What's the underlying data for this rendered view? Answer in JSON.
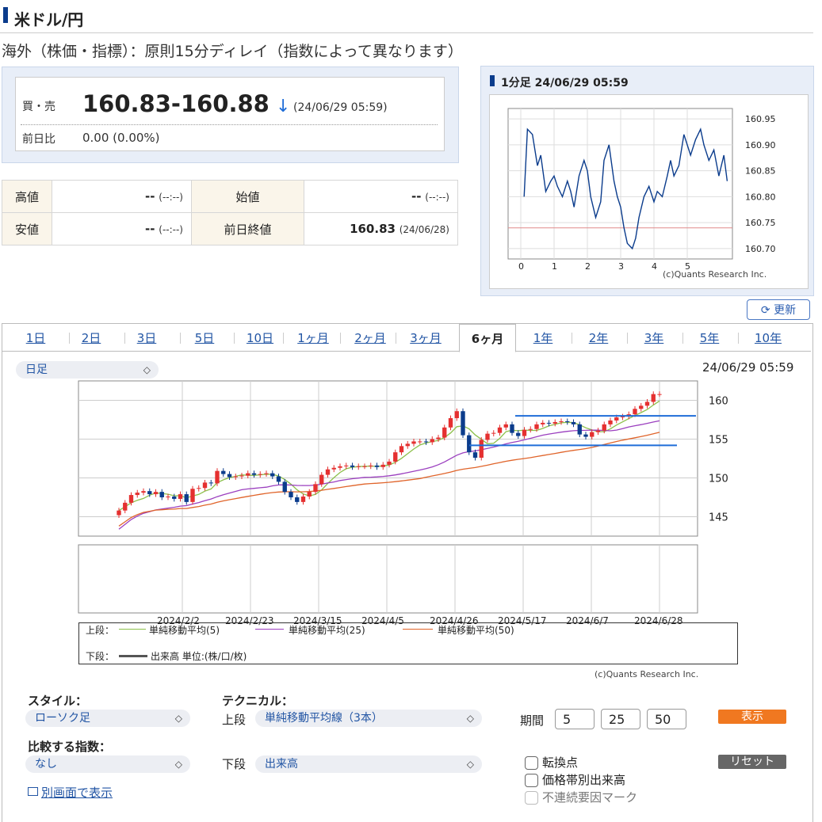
{
  "header": {
    "title": "米ドル/円",
    "subtitle": "海外（株価・指標）：原則15分ディレイ（指数によって異なります）"
  },
  "quote": {
    "bidask_label": "買・売",
    "price": "160.83-160.88",
    "arrow": "↓",
    "time": "(24/06/29 05:59)",
    "change_label": "前日比",
    "change": "0.00 (0.00%)"
  },
  "hl_table": {
    "high_label": "高値",
    "high_value": "--",
    "high_time": "(--:--)",
    "open_label": "始値",
    "open_value": "--",
    "open_time": "(--:--)",
    "low_label": "安値",
    "low_value": "--",
    "low_time": "(--:--)",
    "prev_close_label": "前日終値",
    "prev_close_value": "160.83",
    "prev_close_date": "(24/06/28)"
  },
  "mini_chart": {
    "title": "1分足 24/06/29 05:59",
    "credit": "(c)Quants Research Inc.",
    "y_ticks": [
      "160.95",
      "160.90",
      "160.85",
      "160.80",
      "160.75",
      "160.70"
    ],
    "x_ticks": [
      "0",
      "1",
      "2",
      "3",
      "4",
      "5"
    ]
  },
  "refresh_label": "更新",
  "tabs": [
    "1日",
    "2日",
    "3日",
    "5日",
    "10日",
    "1ヶ月",
    "2ヶ月",
    "3ヶ月",
    "6ヶ月",
    "1年",
    "2年",
    "3年",
    "5年",
    "10年"
  ],
  "active_tab": "6ヶ月",
  "chart_controls": {
    "period_select": "日足",
    "timestamp": "24/06/29 05:59"
  },
  "legend": {
    "upper_label": "上段：",
    "ma5": "単純移動平均(5)",
    "ma25": "単純移動平均(25)",
    "ma50": "単純移動平均(50)",
    "lower_label": "下段：",
    "volume": "出来高 単位:(株/口/枚)"
  },
  "chart_credit": "(c)Quants Research Inc.",
  "controls": {
    "style_label": "スタイル：",
    "style_value": "ローソク足",
    "compare_label": "比較する指数：",
    "compare_value": "なし",
    "technical_label": "テクニカル：",
    "upper_row_label": "上段",
    "upper_value": "単純移動平均線（3本）",
    "lower_row_label": "下段",
    "lower_value": "出来高",
    "period_label": "期間",
    "period1": "5",
    "period2": "25",
    "period3": "50",
    "show_button": "表示",
    "reset_button": "リセット",
    "cb_turning": "転換点",
    "cb_volume_by_price": "価格帯別出来高",
    "cb_discontinuity": "不連続要因マーク",
    "open_new_window": "別画面で表示"
  },
  "colors": {
    "candle_up": "#e53030",
    "candle_down": "#0b3c8c",
    "ma5": "#8cc04a",
    "ma25": "#9b3fbf",
    "ma50": "#e0642a",
    "line_blue": "#1f6dd8",
    "accent_orange": "#f07820"
  },
  "chart_data": [
    {
      "type": "line",
      "title": "1分足 24/06/29 05:59",
      "x_ticks": [
        "0",
        "1",
        "2",
        "3",
        "4",
        "5"
      ],
      "ylim": [
        160.68,
        160.97
      ],
      "reference_line": 160.74,
      "series": [
        {
          "x": [
            0.1,
            0.2,
            0.35,
            0.5,
            0.6,
            0.75,
            0.9,
            1.0,
            1.1,
            1.25,
            1.4,
            1.5,
            1.6,
            1.75,
            1.9,
            2.0,
            2.1,
            2.25,
            2.4,
            2.5,
            2.65,
            2.8,
            2.9,
            3.0,
            3.1,
            3.2,
            3.35,
            3.45,
            3.55,
            3.7,
            3.85,
            4.0,
            4.1,
            4.25,
            4.4,
            4.5,
            4.6,
            4.75,
            4.9,
            5.0,
            5.1,
            5.25,
            5.4,
            5.5,
            5.65,
            5.8,
            5.95,
            6.1,
            6.2
          ],
          "y": [
            160.8,
            160.93,
            160.92,
            160.86,
            160.88,
            160.81,
            160.83,
            160.84,
            160.82,
            160.8,
            160.83,
            160.81,
            160.78,
            160.84,
            160.87,
            160.85,
            160.8,
            160.76,
            160.79,
            160.87,
            160.9,
            160.83,
            160.8,
            160.78,
            160.74,
            160.71,
            160.7,
            160.72,
            160.76,
            160.8,
            160.82,
            160.79,
            160.81,
            160.8,
            160.84,
            160.87,
            160.84,
            160.86,
            160.92,
            160.9,
            160.88,
            160.91,
            160.93,
            160.9,
            160.87,
            160.89,
            160.84,
            160.88,
            160.83
          ]
        }
      ]
    },
    {
      "type": "candlestick",
      "title": "日足",
      "x_tick_labels": [
        "2024/2/2",
        "2024/2/23",
        "2024/3/15",
        "2024/4/5",
        "2024/4/26",
        "2024/5/17",
        "2024/6/7",
        "2024/6/28"
      ],
      "y_ticks": [
        145,
        150,
        155,
        160
      ],
      "ylim": [
        142.5,
        162.5
      ],
      "close": [
        145.8,
        146.8,
        147.8,
        148.1,
        148.3,
        147.9,
        148.2,
        147.5,
        147.6,
        147.3,
        147.9,
        146.9,
        148.6,
        148.7,
        149.4,
        149.3,
        150.9,
        150.5,
        150.1,
        150.2,
        150.3,
        150.6,
        150.4,
        150.5,
        150.6,
        150.2,
        149.5,
        148.2,
        147.5,
        146.9,
        147.6,
        148.2,
        149.2,
        150.4,
        151.1,
        151.3,
        151.5,
        151.6,
        151.4,
        151.5,
        151.5,
        151.6,
        151.4,
        151.7,
        152.1,
        153.3,
        154.1,
        154.4,
        154.7,
        154.7,
        154.6,
        155.0,
        155.2,
        156.5,
        157.7,
        158.6,
        155.5,
        153.3,
        152.6,
        154.9,
        155.7,
        155.8,
        156.5,
        156.9,
        155.8,
        155.4,
        156.2,
        156.3,
        156.9,
        157.1,
        157.0,
        157.2,
        157.3,
        157.2,
        156.9,
        155.6,
        155.3,
        155.9,
        156.1,
        156.9,
        157.4,
        157.8,
        157.9,
        158.2,
        158.9,
        159.3,
        159.8,
        160.8,
        160.8
      ],
      "series": [
        {
          "name": "単純移動平均(5)",
          "values": []
        },
        {
          "name": "単純移動平均(25)",
          "values": []
        },
        {
          "name": "単純移動平均(50)",
          "values": []
        }
      ],
      "horizontal_lines": [
        158.0,
        154.2
      ]
    }
  ]
}
